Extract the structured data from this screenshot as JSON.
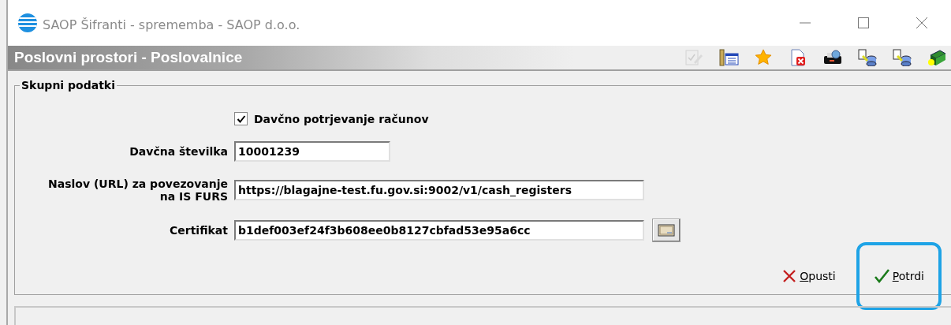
{
  "window": {
    "title": "SAOP Šifranti - sprememba - SAOP d.o.o."
  },
  "header": {
    "title": "Poslovni prostori - Poslovalnice"
  },
  "toolbar": [
    {
      "kind": "edit",
      "disabled": true
    },
    {
      "kind": "columns",
      "disabled": false
    },
    {
      "kind": "star",
      "disabled": false
    },
    {
      "kind": "delete",
      "disabled": false
    },
    {
      "kind": "print",
      "disabled": false
    },
    {
      "kind": "export",
      "disabled": false
    },
    {
      "kind": "import",
      "disabled": false
    },
    {
      "kind": "help",
      "disabled": false
    }
  ],
  "group": {
    "title": "Skupni podatki",
    "checkbox": {
      "label": "Davčno potrjevanje računov",
      "checked": true
    },
    "fields": [
      {
        "kind": "short",
        "label": "Davčna številka",
        "value": "10001239"
      },
      {
        "kind": "long",
        "label": "Naslov (URL) za povezovanje na IS FURS",
        "value": "https://blagajne-test.fu.gov.si:9002/v1/cash_registers"
      },
      {
        "kind": "browse",
        "label": "Certifikat",
        "value": "b1def003ef24f3b608ee0b8127cbfad53e95a6cc"
      }
    ]
  },
  "buttons": [
    {
      "kind": "cancel",
      "label": "Opusti",
      "highlighted": false
    },
    {
      "kind": "confirm",
      "label": "Potrdi",
      "highlighted": true
    }
  ]
}
